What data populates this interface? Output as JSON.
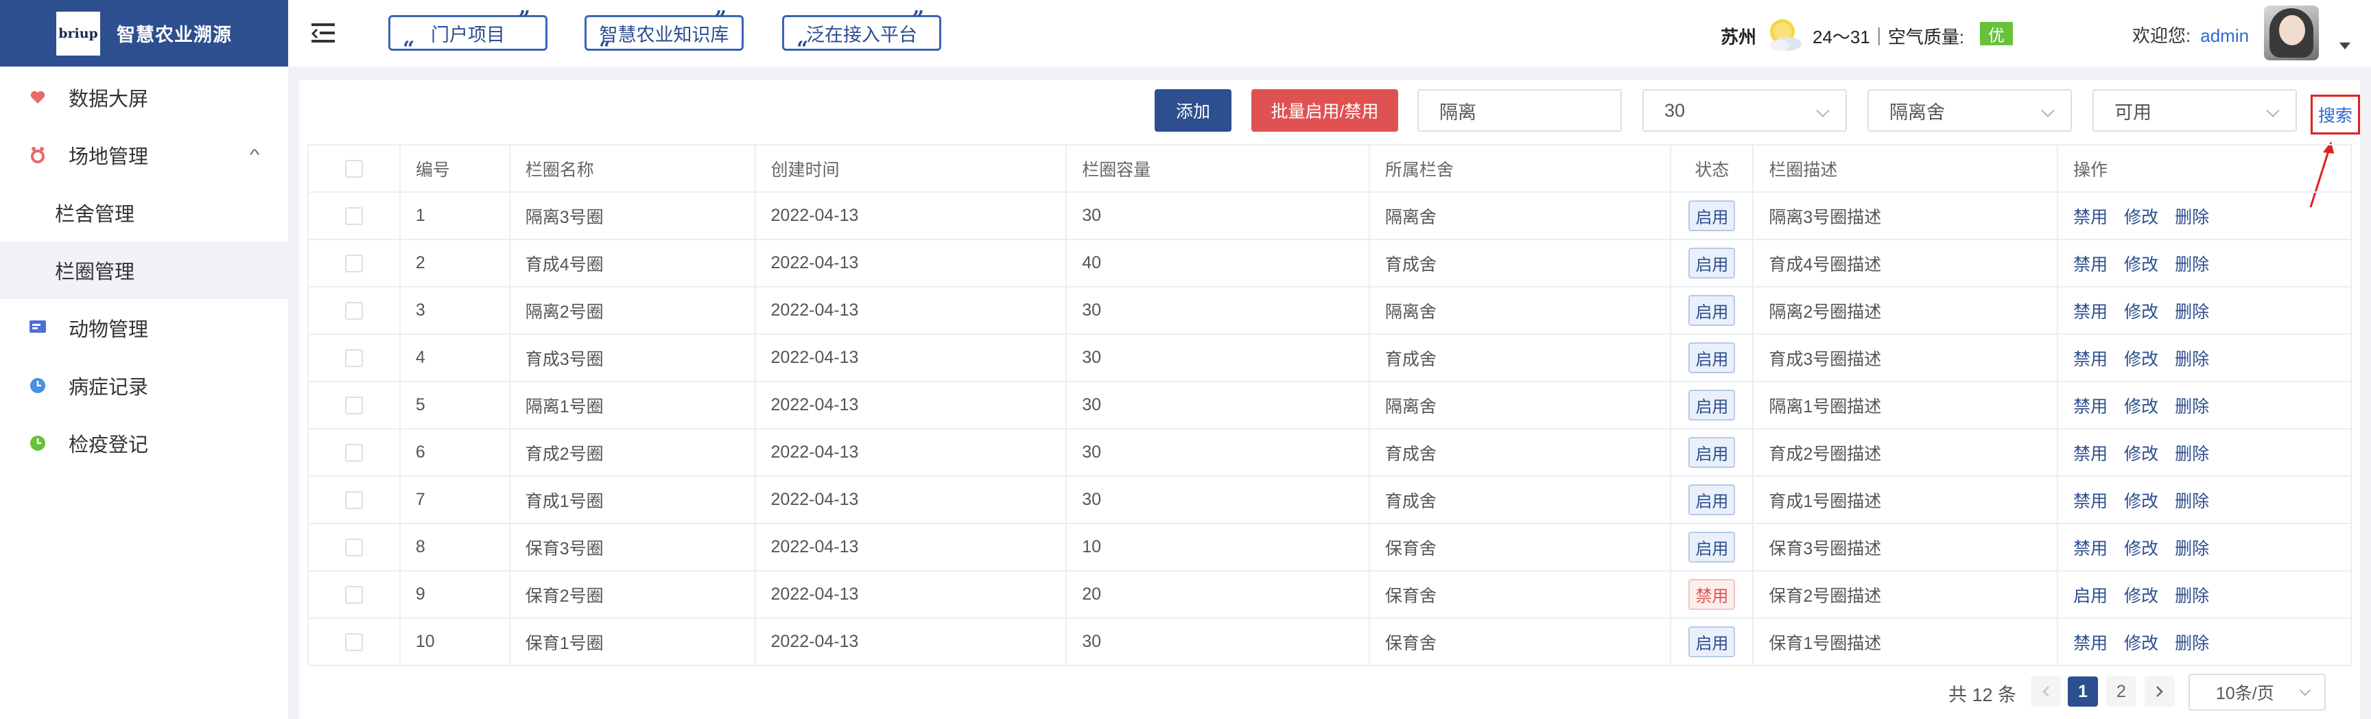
{
  "brand": {
    "logo_text": "briup",
    "name": "智慧农业溯源"
  },
  "sidebar": {
    "items": [
      {
        "label": "数据大屏",
        "icon": "heart-icon",
        "color": "#e86a6a"
      },
      {
        "label": "场地管理",
        "icon": "location-icon",
        "color": "#e86a6a",
        "expanded": true
      },
      {
        "label": "栏舍管理",
        "sub": true
      },
      {
        "label": "栏圈管理",
        "sub": true,
        "active": true
      },
      {
        "label": "动物管理",
        "icon": "list-icon",
        "color": "#4a6fd8"
      },
      {
        "label": "病症记录",
        "icon": "clock-icon",
        "color": "#4a8fe0"
      },
      {
        "label": "检疫登记",
        "icon": "clock-icon",
        "color": "#67c23a"
      }
    ]
  },
  "header": {
    "nav": [
      "门户项目",
      "智慧农业知识库",
      "泛在接入平台"
    ],
    "city": "苏州",
    "weather": "24～31｜空气质量:",
    "aqi": "优",
    "welcome": "欢迎您:",
    "user": "admin"
  },
  "toolbar": {
    "add_label": "添加",
    "batch_label": "批量启用/禁用",
    "name_value": "隔离",
    "capacity_value": "30",
    "barn_value": "隔离舍",
    "status_value": "可用",
    "search_label": "搜索"
  },
  "table": {
    "headers": [
      "编号",
      "栏圈名称",
      "创建时间",
      "栏圈容量",
      "所属栏舍",
      "状态",
      "栏圈描述",
      "操作"
    ],
    "rows": [
      {
        "id": "1",
        "name": "隔离3号圈",
        "created": "2022-04-13",
        "capacity": "30",
        "barn": "隔离舍",
        "status": "启用",
        "desc": "隔离3号圈描述",
        "toggle": "禁用"
      },
      {
        "id": "2",
        "name": "育成4号圈",
        "created": "2022-04-13",
        "capacity": "40",
        "barn": "育成舍",
        "status": "启用",
        "desc": "育成4号圈描述",
        "toggle": "禁用"
      },
      {
        "id": "3",
        "name": "隔离2号圈",
        "created": "2022-04-13",
        "capacity": "30",
        "barn": "隔离舍",
        "status": "启用",
        "desc": "隔离2号圈描述",
        "toggle": "禁用"
      },
      {
        "id": "4",
        "name": "育成3号圈",
        "created": "2022-04-13",
        "capacity": "30",
        "barn": "育成舍",
        "status": "启用",
        "desc": "育成3号圈描述",
        "toggle": "禁用"
      },
      {
        "id": "5",
        "name": "隔离1号圈",
        "created": "2022-04-13",
        "capacity": "30",
        "barn": "隔离舍",
        "status": "启用",
        "desc": "隔离1号圈描述",
        "toggle": "禁用"
      },
      {
        "id": "6",
        "name": "育成2号圈",
        "created": "2022-04-13",
        "capacity": "30",
        "barn": "育成舍",
        "status": "启用",
        "desc": "育成2号圈描述",
        "toggle": "禁用"
      },
      {
        "id": "7",
        "name": "育成1号圈",
        "created": "2022-04-13",
        "capacity": "30",
        "barn": "育成舍",
        "status": "启用",
        "desc": "育成1号圈描述",
        "toggle": "禁用"
      },
      {
        "id": "8",
        "name": "保育3号圈",
        "created": "2022-04-13",
        "capacity": "10",
        "barn": "保育舍",
        "status": "启用",
        "desc": "保育3号圈描述",
        "toggle": "禁用"
      },
      {
        "id": "9",
        "name": "保育2号圈",
        "created": "2022-04-13",
        "capacity": "20",
        "barn": "保育舍",
        "status": "禁用",
        "desc": "保育2号圈描述",
        "toggle": "启用"
      },
      {
        "id": "10",
        "name": "保育1号圈",
        "created": "2022-04-13",
        "capacity": "30",
        "barn": "保育舍",
        "status": "启用",
        "desc": "保育1号圈描述",
        "toggle": "禁用"
      }
    ],
    "edit_label": "修改",
    "delete_label": "删除"
  },
  "pagination": {
    "total": "共 12 条",
    "pages": [
      "1",
      "2"
    ],
    "current": "1",
    "page_size": "10条/页"
  },
  "colors": {
    "primary": "#2d4e8f",
    "danger": "#e05252",
    "success": "#67c23a"
  }
}
